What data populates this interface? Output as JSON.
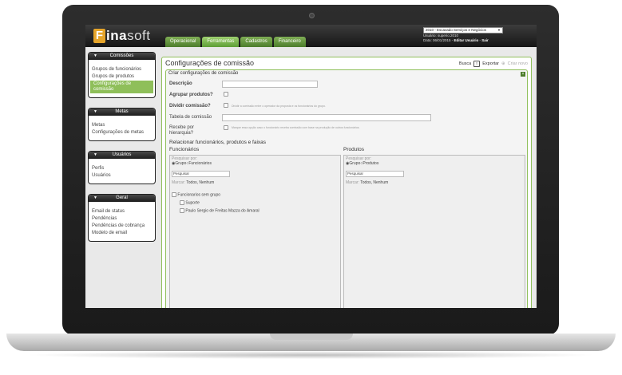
{
  "app": {
    "logo_letter": "F",
    "logo_main": "ina",
    "logo_thin": "soft"
  },
  "tabs": [
    "Operacional",
    "Ferramentas",
    "Cadastros",
    "Financeiro"
  ],
  "topright": {
    "select_value": "2010 - Escavado Serviços e Negócios",
    "user_line": "Usuário: superio.2010",
    "date_line": "Data: 06/01/2015",
    "edit_user": "Editar Usuário",
    "logout": "Sair"
  },
  "sidebar": [
    {
      "title": "Comissões",
      "items": [
        "Grupos de funcionários",
        "Grupos de produtos",
        "Configurações de comissão"
      ],
      "active": 2
    },
    {
      "title": "Metas",
      "items": [
        "Metas",
        "Configurações de metas"
      ],
      "active": -1
    },
    {
      "title": "Usuários",
      "items": [
        "Perfis",
        "Usuários"
      ],
      "active": -1
    },
    {
      "title": "Geral",
      "items": [
        "Email de status",
        "Pendências",
        "Pendências de cobrança",
        "Modelo de email"
      ],
      "active": -1
    }
  ],
  "main": {
    "title": "Configurações de comissão",
    "search_label": "Busca",
    "export_label": "Exportar",
    "new_label": "Criar novo",
    "form_title": "Criar configurações de comissão",
    "description_label": "Descrição",
    "group_products_label": "Agrupar produtos?",
    "split_commission_label": "Dividir comissão?",
    "split_commission_hint": "Dividir a comissão entre o operador da proposta e os funcionários do grupo.",
    "commission_table_label": "Tabela de comissão",
    "hierarchy_label": "Recebe por hierarquia?",
    "hierarchy_hint": "Marque essa opção caso o funcionário receba comissão com base na produção de outros funcionários.",
    "relate_title": "Relacionar funcionários, produtos e faixas",
    "employees_col": "Funcionários",
    "products_col": "Produtos",
    "search_by": "Pesquisar por:",
    "group_option": "Grupo",
    "employees_option": "Funcionários",
    "products_option": "Produtos",
    "search_placeholder": "Pesquisar",
    "mark_label": "Marcar:",
    "mark_values": "Todos, Nenhum",
    "no_group_label": "Funcionarios sem grupo",
    "employee_items": [
      "Suporte",
      "Paulo Sergio de Freitas Mazza do Amaral"
    ]
  }
}
